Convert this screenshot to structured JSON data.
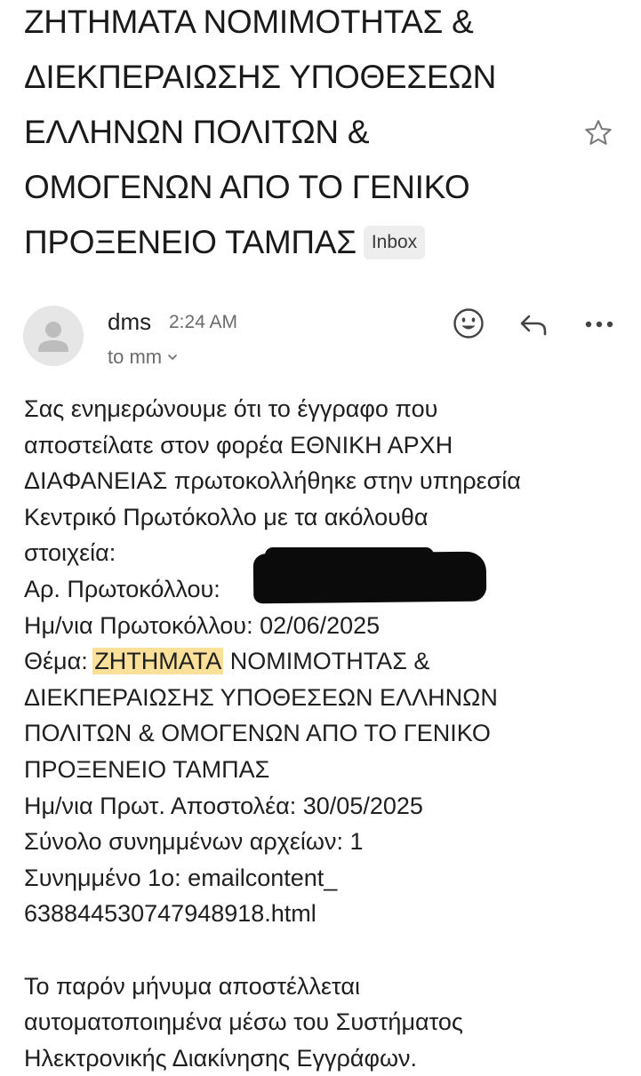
{
  "email": {
    "subject_lines": [
      "ΖΗΤΗΜΑΤΑ ΝΟΜΙΜΟΤΗΤΑΣ &",
      "ΔΙΕΚΠΕΡΑΙΩΣΗΣ ΥΠΟΘΕΣΕΩΝ",
      "ΕΛΛΗΝΩΝ ΠΟΛΙΤΩΝ &",
      "ΟΜΟΓΕΝΩΝ ΑΠΟ ΤΟ ΓΕΝΙΚΟ",
      "ΠΡΟΞΕΝΕΙΟ ΤΑΜΠΑΣ"
    ],
    "label_badge": "Inbox",
    "sender": "dms",
    "time": "2:24 AM",
    "recipient": "to mm",
    "body": {
      "intro": [
        "Σας ενημερώνουμε ότι το έγγραφο που",
        "αποστείλατε στον φορέα ΕΘΝΙΚΗ ΑΡΧΗ",
        "ΔΙΑΦΑΝΕΙΑΣ πρωτοκολλήθηκε στην υπηρεσία",
        "Κεντρικό Πρωτόκολλο με τα ακόλουθα",
        "στοιχεία:"
      ],
      "protocol_number_label": "Αρ. Πρωτοκόλλου:",
      "protocol_date": "Ημ/νια Πρωτοκόλλου: 02/06/2025",
      "topic_label": "Θέμα:",
      "topic_highlight": "ΖΗΤΗΜΑΤΑ",
      "topic_rest_first": " ΝΟΜΙΜΟΤΗΤΑΣ &",
      "topic_lines": [
        "ΔΙΕΚΠΕΡΑΙΩΣΗΣ ΥΠΟΘΕΣΕΩΝ ΕΛΛΗΝΩΝ",
        "ΠΟΛΙΤΩΝ & ΟΜΟΓΕΝΩΝ ΑΠΟ ΤΟ ΓΕΝΙΚΟ",
        "ΠΡΟΞΕΝΕΙΟ ΤΑΜΠΑΣ"
      ],
      "sender_date": "Ημ/νια Πρωτ. Αποστολέα: 30/05/2025",
      "attachments_count": "Σύνολο συνημμένων αρχείων: 1",
      "attachment_1": "Συνημμένο 1ο: emailcontent_",
      "attachment_1_cont": "638844530747948918.html",
      "footer": [
        "Το παρόν μήνυμα αποστέλλεται",
        "αυτοματοποιημένα μέσω του Συστήματος",
        "Ηλεκτρονικής Διακίνησης Εγγράφων."
      ]
    }
  },
  "icons": {
    "star": "star-outline-icon",
    "avatar": "person-placeholder-icon",
    "chevron": "chevron-down-icon",
    "emoji": "emoji-reaction-icon",
    "reply": "reply-icon",
    "more": "more-horizontal-icon"
  },
  "colors": {
    "highlight": "#fbe09a",
    "badge_bg": "#eeeeee",
    "secondary_text": "#6b6b6b",
    "avatar_bg": "#e6e6e6"
  }
}
